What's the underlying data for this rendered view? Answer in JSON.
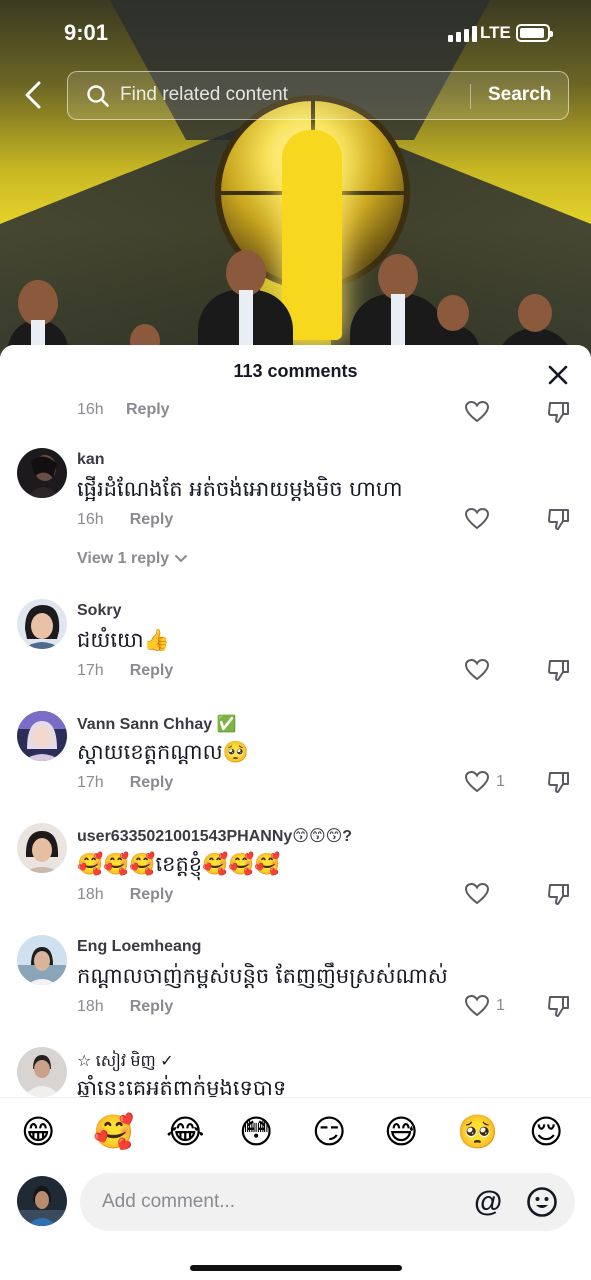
{
  "status_bar": {
    "time": "9:01",
    "network": "LTE"
  },
  "search": {
    "placeholder": "Find related content",
    "button_label": "Search"
  },
  "sheet": {
    "comment_count": "113 comments"
  },
  "top_partial": {
    "time": "16h",
    "reply_label": "Reply"
  },
  "comments": [
    {
      "username": "kan",
      "text": "ផ្អើរដំណែងតែ អត់ចង់អោយម្តងមិច ហាហា",
      "time": "16h",
      "reply_label": "Reply",
      "likes": "",
      "view_replies": "View 1 reply"
    },
    {
      "username": "Sokry",
      "text": "ជយំយោ👍",
      "time": "17h",
      "reply_label": "Reply",
      "likes": ""
    },
    {
      "username": "Vann Sann Chhay ✅",
      "text": "ស្តាយខេត្តកណ្តាល🥺",
      "time": "17h",
      "reply_label": "Reply",
      "likes": "1"
    },
    {
      "username": "user6335021001543PHANNy😙😙😙?",
      "text": "🥰🥰🥰ខេត្តខ្ញុំ🥰🥰🥰",
      "time": "18h",
      "reply_label": "Reply",
      "likes": ""
    },
    {
      "username": "Eng Loemheang",
      "text": "កណ្តាលចាញ់កម្ពស់បន្តិច តែញញឹមស្រស់ណាស់",
      "time": "18h",
      "reply_label": "Reply",
      "likes": "1"
    },
    {
      "username": "☆ សៀវ មិញ ✓",
      "text": "ឆ្នាំនេះគេអត់ពាក់ម្តងទេបាទ",
      "time": "",
      "reply_label": "",
      "likes": ""
    }
  ],
  "emoji_bar": [
    "😁",
    "🥰",
    "😂",
    "😳",
    "😏",
    "😅",
    "🥺",
    "😌"
  ],
  "input": {
    "placeholder": "Add comment...",
    "at_symbol": "@"
  },
  "colors": {
    "accent_text": "#161823",
    "muted": "#8a8b91",
    "sheet_bg": "#ffffff"
  }
}
